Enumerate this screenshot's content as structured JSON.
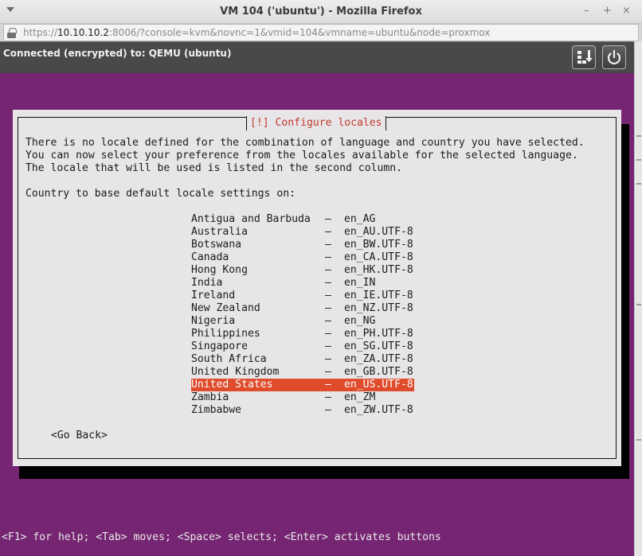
{
  "window": {
    "title": "VM 104 ('ubuntu') - Mozilla Firefox",
    "controls": {
      "minimize": "–",
      "maximize": "+",
      "close": "×"
    }
  },
  "urlbar": {
    "scheme": "https://",
    "host": "10.10.10.2",
    "rest": ":8006/?console=kvm&novnc=1&vmid=104&vmname=ubuntu&node=proxmox"
  },
  "novnc": {
    "status": "Connected (encrypted) to: QEMU (ubuntu)",
    "icons": [
      "send-keys-icon",
      "power-icon"
    ]
  },
  "installer": {
    "dialog_title": "[!] Configure locales",
    "intro_lines": [
      "There is no locale defined for the combination of language and country you have selected.",
      "You can now select your preference from the locales available for the selected language.",
      "The locale that will be used is listed in the second column."
    ],
    "prompt": "Country to base default locale settings on:",
    "separator": "–",
    "locales": [
      {
        "country": "Antigua and Barbuda",
        "locale": "en_AG"
      },
      {
        "country": "Australia",
        "locale": "en_AU.UTF-8"
      },
      {
        "country": "Botswana",
        "locale": "en_BW.UTF-8"
      },
      {
        "country": "Canada",
        "locale": "en_CA.UTF-8"
      },
      {
        "country": "Hong Kong",
        "locale": "en_HK.UTF-8"
      },
      {
        "country": "India",
        "locale": "en_IN"
      },
      {
        "country": "Ireland",
        "locale": "en_IE.UTF-8"
      },
      {
        "country": "New Zealand",
        "locale": "en_NZ.UTF-8"
      },
      {
        "country": "Nigeria",
        "locale": "en_NG"
      },
      {
        "country": "Philippines",
        "locale": "en_PH.UTF-8"
      },
      {
        "country": "Singapore",
        "locale": "en_SG.UTF-8"
      },
      {
        "country": "South Africa",
        "locale": "en_ZA.UTF-8"
      },
      {
        "country": "United Kingdom",
        "locale": "en_GB.UTF-8"
      },
      {
        "country": "United States",
        "locale": "en_US.UTF-8"
      },
      {
        "country": "Zambia",
        "locale": "en_ZM"
      },
      {
        "country": "Zimbabwe",
        "locale": "en_ZW.UTF-8"
      }
    ],
    "selected_country": "United States",
    "go_back": "<Go Back>",
    "help_line": "<F1> for help; <Tab> moves; <Space> selects; <Enter> activates buttons"
  },
  "colors": {
    "console_background": "#762572",
    "dialog_background": "#e8e5e8",
    "selection": "#de4c2c",
    "title_text": "#c0392b"
  }
}
